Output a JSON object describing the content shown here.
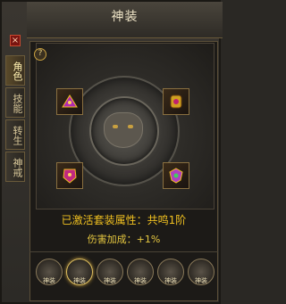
{
  "window": {
    "title": "神装",
    "close_label": "×"
  },
  "side_tabs": [
    {
      "label": "角色",
      "active": true
    },
    {
      "label": "技能",
      "active": false
    },
    {
      "label": "转生",
      "active": false
    },
    {
      "label": "神戒",
      "active": false
    }
  ],
  "panel": {
    "help_label": "?"
  },
  "slots": [
    {
      "icon": "helmet-gem-icon",
      "color": "#b02ab0"
    },
    {
      "icon": "gauntlet-gem-icon",
      "color": "#d0a020"
    },
    {
      "icon": "armor-gem-icon",
      "color": "#c02880"
    },
    {
      "icon": "shield-gem-icon",
      "color": "#b040c0"
    }
  ],
  "status": {
    "set_attribute_text": "已激活套装属性：共鸣1阶",
    "damage_bonus_label": "伤害加成：",
    "damage_bonus_value": "+1%"
  },
  "bottom_tabs": [
    {
      "label": "神装",
      "active": false
    },
    {
      "label": "神装",
      "active": true
    },
    {
      "label": "神装",
      "active": false
    },
    {
      "label": "神装",
      "active": false
    },
    {
      "label": "神装",
      "active": false
    },
    {
      "label": "神装",
      "active": false
    }
  ],
  "colors": {
    "accent_gold": "#f0c020",
    "frame": "#5a4e38",
    "close_red": "#7a1410"
  }
}
